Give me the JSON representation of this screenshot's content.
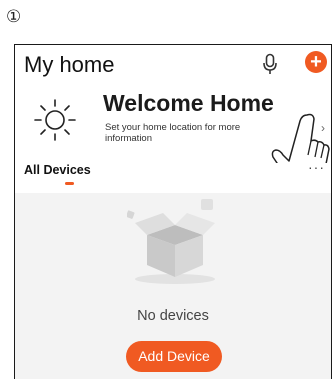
{
  "step_marker": "①",
  "header": {
    "title": "My home",
    "mic_icon": "microphone-icon",
    "add_icon": "plus-circle-icon",
    "add_label": "+"
  },
  "welcome_card": {
    "icon": "sun-icon",
    "title": "Welcome Home",
    "subtitle": "Set your home location for more information",
    "chevron": "›"
  },
  "tabs": {
    "active_label": "All Devices",
    "more_label": "···"
  },
  "empty_state": {
    "icon": "empty-box-icon",
    "message": "No devices",
    "add_button_label": "Add Device"
  },
  "colors": {
    "accent": "#f05a22",
    "background": "#f3f3f3"
  }
}
